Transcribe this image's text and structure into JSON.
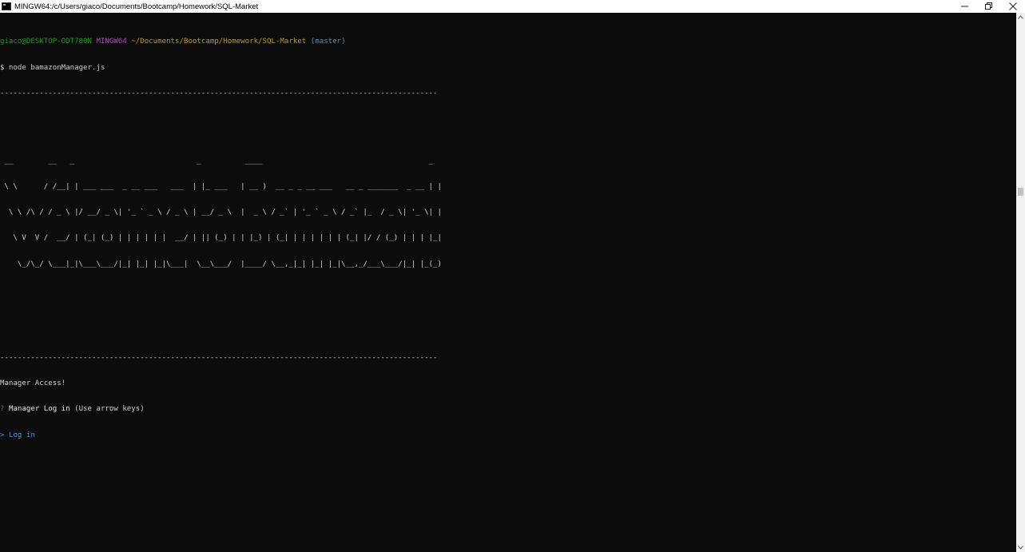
{
  "window": {
    "title": "MINGW64:/c/Users/giaco/Documents/Bootcamp/Homework/SQL-Market",
    "icon": "terminal-icon",
    "controls": [
      "minimize-icon",
      "restore-icon",
      "close-icon"
    ]
  },
  "prompt": {
    "user_host": "giaco@DESKTOP-ODT780N",
    "system": "MINGW64",
    "path": "~/Documents/Bootcamp/Homework/SQL-Market",
    "branch": "(master)",
    "symbol": "$",
    "command": "node bamazonManager.js"
  },
  "banner": {
    "rule": "----------------------------------------------------------------------------------------------------",
    "art": [
      " __        __   _                            _          ____                                      _ ",
      " \\ \\      / /__| | ___ ___  _ __ ___   ___  | |_ ___   | __ )  __ _ _ __ ___   __ _ _______  _ __ | |",
      "  \\ \\ /\\ / / _ \\ |/ __/ _ \\| '_ ` _ \\ / _ \\ | __/ _ \\  |  _ \\ / _` | '_ ` _ \\ / _` |_  / _ \\| '_ \\| |",
      "   \\ V  V /  __/ | (_| (_) | | | | | |  __/ | || (_) | | |_) | (_| | | | | | | (_| |/ / (_) | | | |_|",
      "    \\_/\\_/ \\___|_|\\___\\___/|_| |_| |_|\\___|  \\__\\___/  |____/ \\__,_|_| |_| |_|\\__,_/___\\___/|_| |_(_)"
    ]
  },
  "output": {
    "access": "Manager Access!",
    "question_mark": "?",
    "question": "Manager Log in",
    "hint": "(Use arrow keys)",
    "pointer": ">",
    "option": "Log in"
  },
  "colors": {
    "background": "#0c0c0c",
    "user_host": "#13a10e",
    "system": "#b148c6",
    "path": "#c19c00",
    "branch": "#3a96dd",
    "selected": "#3a96dd"
  }
}
